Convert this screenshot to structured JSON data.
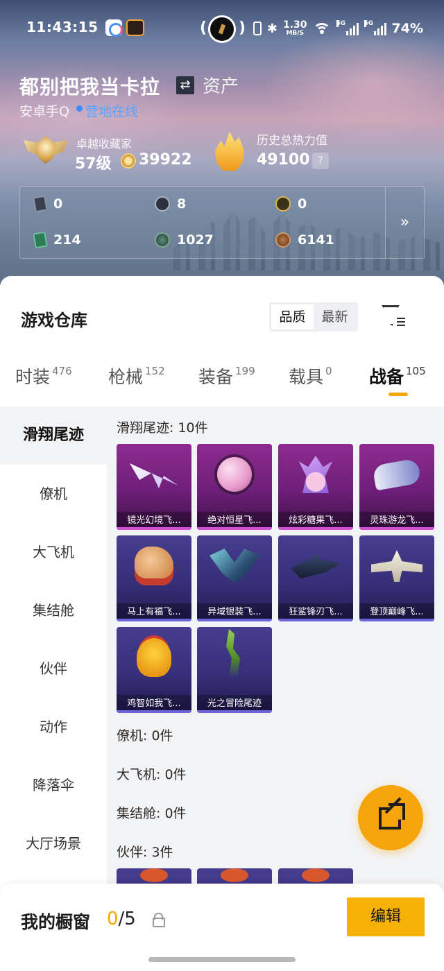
{
  "status_bar": {
    "time": "11:43:15",
    "net_speed": "1.30",
    "net_unit": "MB/S",
    "sig1": "5G",
    "sig2": "5G",
    "battery": "74%"
  },
  "profile": {
    "name": "都别把我当卡拉",
    "swap_glyph": "⇄",
    "asset_label": "资产",
    "platform": "安卓手Q",
    "status": "营地在线",
    "rank_title": "卓越收藏家",
    "level": "57级",
    "coins": "39922",
    "heat_title": "历史总热力值",
    "heat_value": "49100",
    "help_glyph": "?"
  },
  "stats": {
    "row1": [
      "0",
      "8",
      "0"
    ],
    "row2": [
      "214",
      "1027",
      "6141"
    ],
    "more_glyph": "»"
  },
  "warehouse": {
    "title": "游戏仓库",
    "sort_options": [
      "品质",
      "最新"
    ],
    "sort_active": "品质"
  },
  "tabs": [
    {
      "label": "时装",
      "count": "476"
    },
    {
      "label": "枪械",
      "count": "152"
    },
    {
      "label": "装备",
      "count": "199"
    },
    {
      "label": "载具",
      "count": "0"
    },
    {
      "label": "战备",
      "count": "105"
    }
  ],
  "sidebar": [
    "滑翔尾迹",
    "僚机",
    "大飞机",
    "集结舱",
    "伙伴",
    "动作",
    "降落伞",
    "大厅场景"
  ],
  "sections": {
    "glide": {
      "title": "滑翔尾迹: 10件"
    },
    "wingman": {
      "title": "僚机: 0件"
    },
    "plane": {
      "title": "大飞机: 0件"
    },
    "pod": {
      "title": "集结舱: 0件"
    },
    "partner": {
      "title": "伙伴: 3件"
    }
  },
  "items": [
    {
      "name": "镜光幻境飞...",
      "rarity": "purple",
      "icon": "crystal-wing-icon"
    },
    {
      "name": "绝对恒星飞...",
      "rarity": "purple",
      "icon": "planet-icon"
    },
    {
      "name": "炫彩糖果飞...",
      "rarity": "purple",
      "icon": "candy-icon"
    },
    {
      "name": "灵珠游龙飞...",
      "rarity": "purple",
      "icon": "dragon-icon"
    },
    {
      "name": "马上有福飞...",
      "rarity": "blue",
      "icon": "horse-icon"
    },
    {
      "name": "异域银装飞...",
      "rarity": "blue",
      "icon": "beast-icon"
    },
    {
      "name": "狂鲨锋刃飞...",
      "rarity": "blue",
      "icon": "shark-icon"
    },
    {
      "name": "登顶巅峰飞...",
      "rarity": "blue",
      "icon": "jet-icon"
    },
    {
      "name": "鸡智如我飞...",
      "rarity": "blue",
      "icon": "chick-icon"
    },
    {
      "name": "光之冒险尾迹",
      "rarity": "blue",
      "icon": "smoke-trail-icon"
    }
  ],
  "showcase": {
    "label": "我的橱窗",
    "current": "0",
    "total": "/5",
    "edit_label": "编辑"
  },
  "colors": {
    "accent": "#f5a600",
    "purple_tier": "#8e2b8f",
    "blue_tier": "#463d8f"
  }
}
